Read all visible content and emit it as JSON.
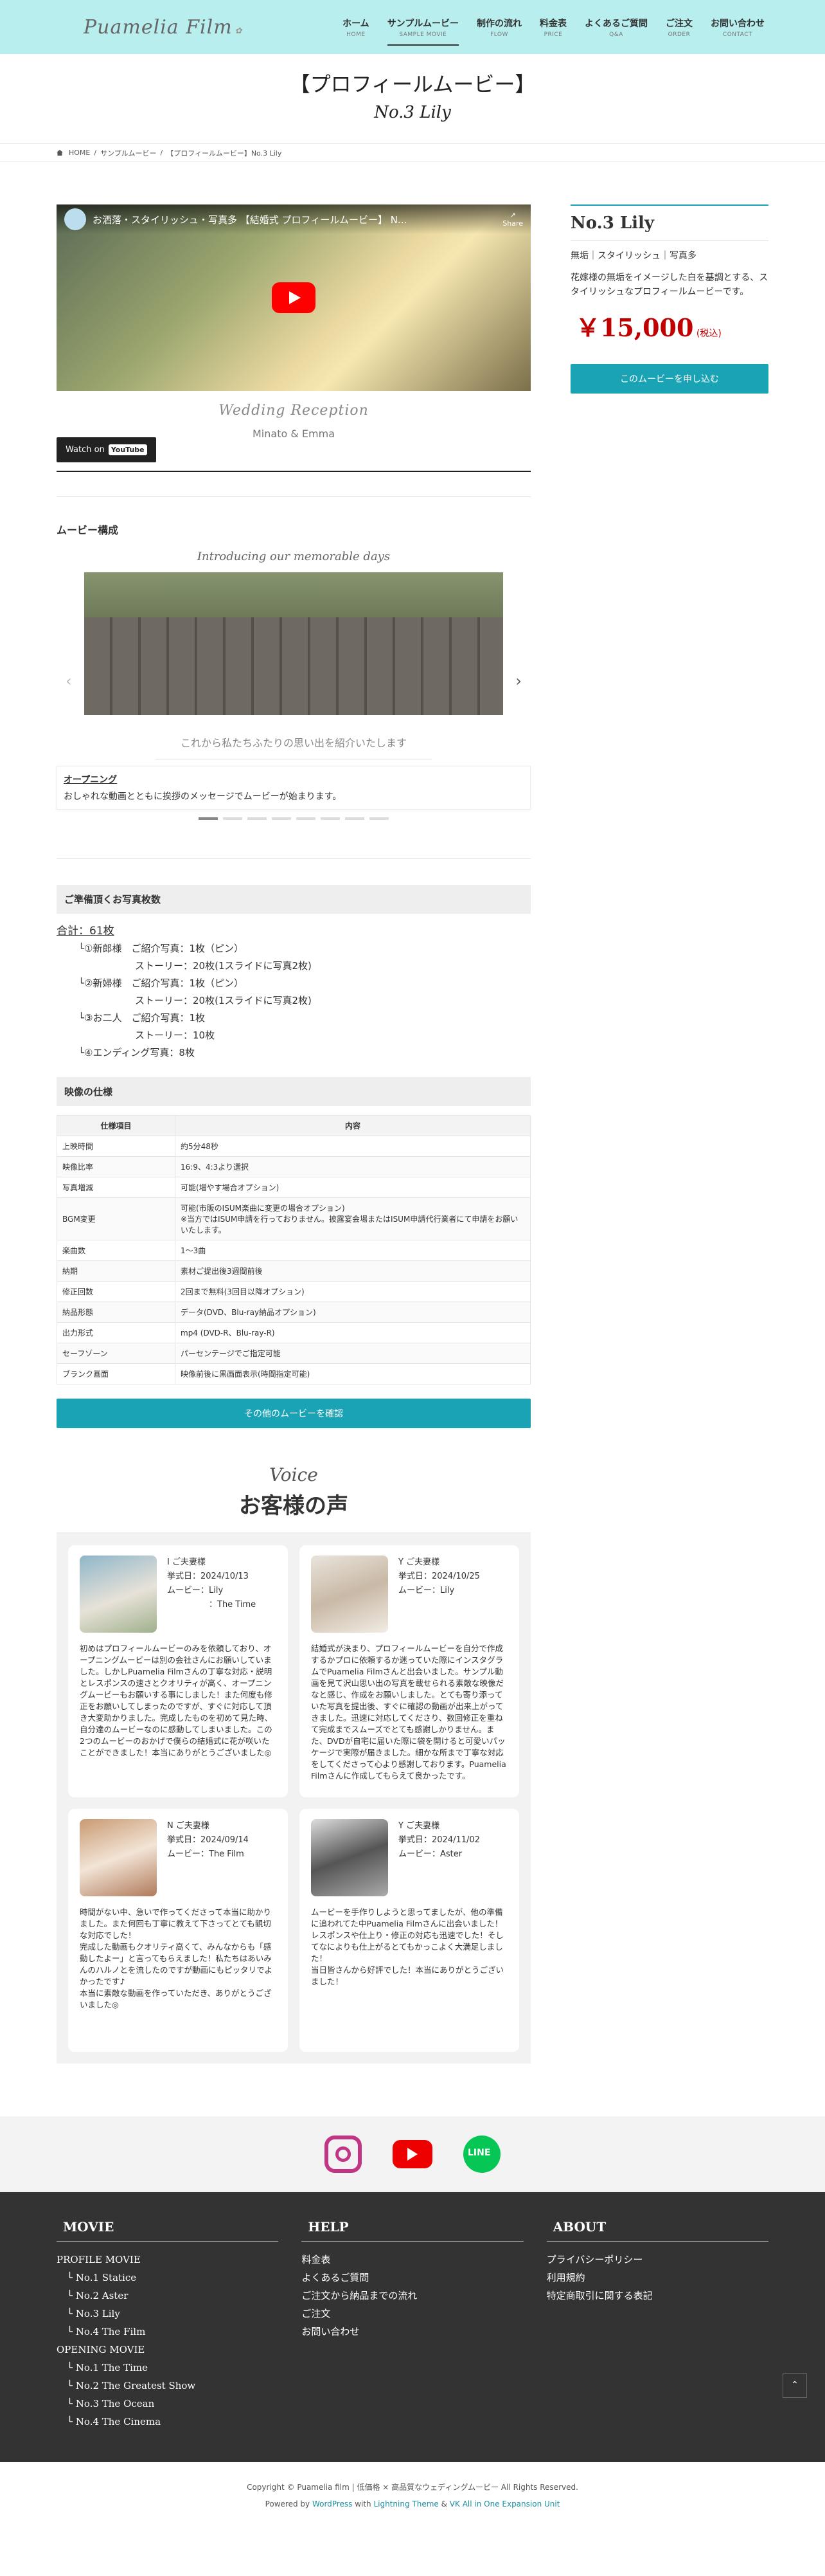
{
  "header": {
    "logo": "Puamelia Film",
    "logo_sub": "✿",
    "nav": [
      {
        "jp": "ホーム",
        "en": "HOME"
      },
      {
        "jp": "サンプルムービー",
        "en": "SAMPLE MOVIE"
      },
      {
        "jp": "制作の流れ",
        "en": "FLOW"
      },
      {
        "jp": "料金表",
        "en": "PRICE"
      },
      {
        "jp": "よくあるご質問",
        "en": "Q&A"
      },
      {
        "jp": "ご注文",
        "en": "ORDER"
      },
      {
        "jp": "お問い合わせ",
        "en": "CONTACT"
      }
    ]
  },
  "page": {
    "title": "【プロフィールムービー】",
    "subtitle": "No.3 Lily"
  },
  "breadcrumb": [
    "HOME",
    "/",
    "サンプルムービー",
    "/",
    "【プロフィールムービー】No.3 Lily"
  ],
  "video": {
    "title": "お洒落・スタイリッシュ・写真多 【結婚式 プロフィールムービー】 N...",
    "share": "Share",
    "script": "Wedding Reception",
    "names": "Minato & Emma",
    "watch": "Watch on",
    "yt": "YouTube"
  },
  "sidebar": {
    "title": "No.3 Lily",
    "tags": "無垢｜スタイリッシュ｜写真多",
    "desc": "花嫁様の無垢をイメージした白を基調とする、スタイリッシュなプロフィールムービーです。",
    "price": "￥15,000",
    "tax": "(税込)",
    "button": "このムービーを申し込む"
  },
  "composition": {
    "heading": "ムービー構成",
    "slide_title": "Introducing our memorable days",
    "slide_caption": "これから私たちふたりの思い出を紹介いたします",
    "op_title": "オープニング",
    "op_desc": "おしゃれな動画とともに挨拶のメッセージでムービーが始まります。",
    "prev": "‹",
    "next": "›"
  },
  "photos": {
    "heading": "ご準備頂くお写真枚数",
    "total": "合計：61枚",
    "lines": [
      {
        "a": "└①新郎様　ご紹介写真：1枚（ピン）",
        "b": "ストーリー：20枚(1スライドに写真2枚)"
      },
      {
        "a": "└②新婦様　ご紹介写真：1枚（ピン）",
        "b": "ストーリー：20枚(1スライドに写真2枚)"
      },
      {
        "a": "└③お二人　ご紹介写真：1枚",
        "b": "ストーリー：10枚"
      },
      {
        "a": "└④エンディング写真：8枚",
        "b": ""
      }
    ]
  },
  "spec": {
    "heading": "映像の仕様",
    "col1": "仕様項目",
    "col2": "内容",
    "rows": [
      [
        "上映時間",
        "約5分48秒"
      ],
      [
        "映像比率",
        "16:9、4:3より選択"
      ],
      [
        "写真増減",
        "可能(増やす場合オプション)"
      ],
      [
        "BGM変更",
        "可能(市販のISUM楽曲に変更の場合オプション)\n※当方ではISUM申請を行っておりません。披露宴会場またはISUM申請代行業者にて申請をお願いいたします。"
      ],
      [
        "楽曲数",
        "1～3曲"
      ],
      [
        "納期",
        "素材ご提出後3週間前後"
      ],
      [
        "修正回数",
        "2回まで無料(3回目以降オプション)"
      ],
      [
        "納品形態",
        "データ(DVD、Blu-ray納品オプション)"
      ],
      [
        "出力形式",
        "mp4 (DVD-R、Blu-ray-R)"
      ],
      [
        "セーフゾーン",
        "パーセンテージでご指定可能"
      ],
      [
        "ブランク画面",
        "映像前後に黒画面表示(時間指定可能)"
      ]
    ],
    "button": "その他のムービーを確認"
  },
  "voice": {
    "script": "Voice",
    "heading": "お客様の声",
    "items": [
      {
        "name": "I ご夫妻様",
        "date": "挙式日：2024/10/13",
        "movie": "ムービー：Lily",
        "movie2": "　　　　　：The Time",
        "body": "初めはプロフィールムービーのみを依頼しており、オープニングムービーは別の会社さんにお願いしていました。しかしPuamelia Filmさんの丁寧な対応・説明とレスポンスの速さとクオリティが高く、オープニングムービーもお願いする事にしました！また何度も修正をお願いしてしまったのですが、すぐに対応して頂き大変助かりました。完成したものを初めて見た時、自分達のムービーなのに感動してしまいました。この2つのムービーのおかげで僕らの結婚式に花が咲いたことができました！本当にありがとうございました◎"
      },
      {
        "name": "Y ご夫妻様",
        "date": "挙式日：2024/10/25",
        "movie": "ムービー：Lily",
        "movie2": "",
        "body": "結婚式が決まり、プロフィールムービーを自分で作成するかプロに依頼するか迷っていた際にインスタグラムでPuamelia Filmさんと出会いました。サンプル動画を見て沢山思い出の写真を載せられる素敵な映像だなと感じ、作成をお願いしました。とても寄り添っていた写真を提出後、すぐに確認の動画が出来上がってきました。迅速に対応してくださり、数回修正を重ねて完成までスムーズでとても感謝しかりません。また、DVDが自宅に届いた際に袋を開けると可愛いパッケージで実際が届きました。細かな所まで丁寧な対応をしてくださって心より感謝しております。Puamelia Filmさんに作成してもらえて良かったです。"
      },
      {
        "name": "N ご夫妻様",
        "date": "挙式日：2024/09/14",
        "movie": "ムービー：The Film",
        "movie2": "",
        "body": "時間がない中、急いで作ってくださって本当に助かりました。また何回も丁寧に教えて下さってとても親切な対応でした！\n完成した動画もクオリティ高くて、みんなからも「感動したよー」と言ってもらえました！私たちはあいみんのハルノとを流したのですが動画にもピッタリでよかったです♪\n本当に素敵な動画を作っていただき、ありがとうございました◎"
      },
      {
        "name": "Y ご夫妻様",
        "date": "挙式日：2024/11/02",
        "movie": "ムービー：Aster",
        "movie2": "",
        "body": "ムービーを手作りしようと思ってましたが、他の準備に追われてた中Puamelia Filmさんに出会いました！\nレスポンスや仕上り・修正の対応も迅速でした！そしてなによりも仕上がるとてもかっこよく大満足しました！\n当日皆さんから好評でした！本当にありがとうございました！"
      }
    ]
  },
  "footer": {
    "movie": {
      "h": "MOVIE",
      "items": [
        "PROFILE MOVIE",
        "└ No.1 Statice",
        "└ No.2 Aster",
        "└ No.3 Lily",
        "└ No.4 The Film",
        "OPENING MOVIE",
        "└ No.1 The Time",
        "└ No.2 The Greatest Show",
        "└ No.3 The Ocean",
        "└ No.4 The Cinema"
      ]
    },
    "help": {
      "h": "HELP",
      "items": [
        "料金表",
        "よくあるご質問",
        "ご注文から納品までの流れ",
        "ご注文",
        "お問い合わせ"
      ]
    },
    "about": {
      "h": "ABOUT",
      "items": [
        "プライバシーポリシー",
        "利用規約",
        "特定商取引に関する表記"
      ]
    },
    "top": "⌃",
    "copy1": "Copyright © Puamelia film | 低価格 × 高品質なウェディングムービー All Rights Reserved.",
    "copy2a": "Powered by ",
    "copy2b": "WordPress",
    "copy2c": " with ",
    "copy2d": "Lightning Theme",
    "copy2e": " & ",
    "copy2f": "VK All in One Expansion Unit"
  },
  "colors": {
    "accent": "#1aa3b4",
    "header_bg": "#b8eeee",
    "price": "#c00000"
  }
}
